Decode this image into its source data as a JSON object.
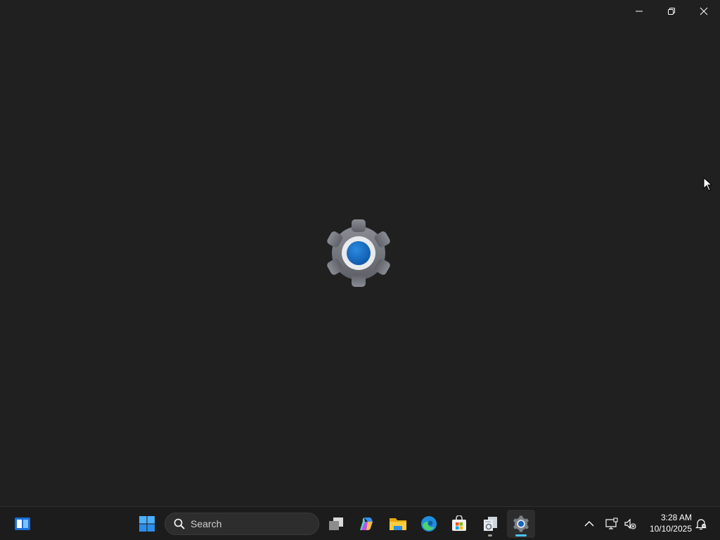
{
  "window": {
    "caption_buttons": [
      {
        "name": "minimize",
        "icon": "minimize-icon"
      },
      {
        "name": "restore",
        "icon": "restore-icon"
      },
      {
        "name": "close",
        "icon": "close-icon"
      }
    ],
    "splash_icon": "settings-gear-icon",
    "background": "#202020"
  },
  "taskbar": {
    "search": {
      "label": "Search",
      "icon": "search-icon"
    },
    "apps": [
      {
        "name": "widgets",
        "icon": "widgets-icon"
      },
      {
        "name": "start",
        "icon": "windows-start-icon"
      },
      {
        "name": "task-view",
        "icon": "task-view-icon"
      },
      {
        "name": "copilot",
        "icon": "copilot-icon"
      },
      {
        "name": "file-explorer",
        "icon": "folder-icon"
      },
      {
        "name": "edge",
        "icon": "edge-icon"
      },
      {
        "name": "microsoft-store",
        "icon": "store-icon"
      },
      {
        "name": "file-tool",
        "icon": "document-tool-icon"
      },
      {
        "name": "settings",
        "icon": "settings-gear-icon",
        "active": true
      }
    ],
    "tray": {
      "icons": [
        "chevron-up-icon",
        "network-icon",
        "volume-muted-icon",
        "notification-bell-icon"
      ],
      "time": "3:28 AM",
      "date": "10/10/2025"
    },
    "accent": "#4cc2ff"
  }
}
